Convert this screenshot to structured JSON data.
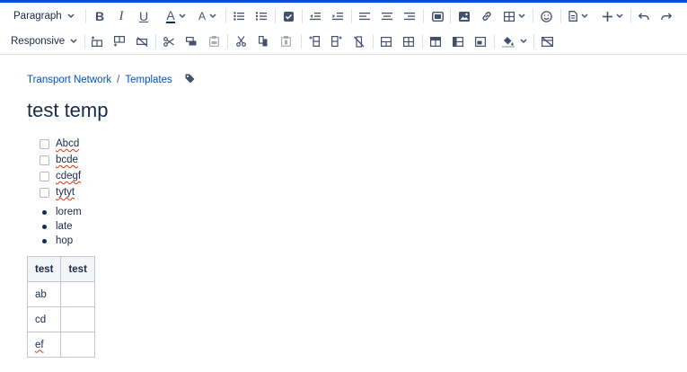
{
  "toolbar": {
    "paragraph_label": "Paragraph",
    "responsive_label": "Responsive",
    "bold_label": "B",
    "italic_label": "I",
    "underline_label": "U",
    "text_color_label": "A",
    "text_style_label": "A",
    "accent_color": "#0052cc",
    "icon_color": "#42526e"
  },
  "breadcrumb": {
    "items": [
      "Transport Network",
      "Templates"
    ],
    "separator": "/"
  },
  "page": {
    "title": "test temp"
  },
  "tasks": [
    {
      "label": "Abcd",
      "checked": false
    },
    {
      "label": "bcde",
      "checked": false
    },
    {
      "label": "cdegf",
      "checked": false
    },
    {
      "label": "tytyt",
      "checked": false
    }
  ],
  "bullets": [
    "lorem",
    "late",
    "hop"
  ],
  "table": {
    "headers": [
      "test",
      "test"
    ],
    "rows": [
      [
        "ab",
        ""
      ],
      [
        "cd",
        ""
      ],
      [
        "ef",
        ""
      ]
    ]
  }
}
